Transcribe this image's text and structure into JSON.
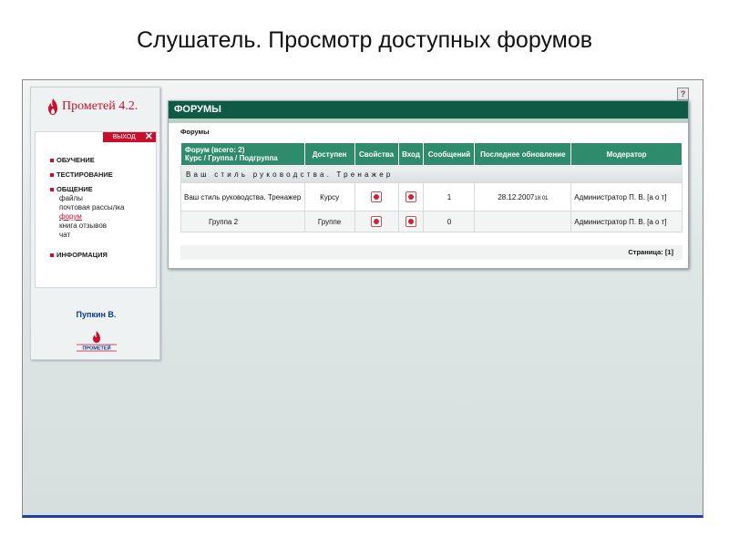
{
  "slide": {
    "title": "Слушатель. Просмотр доступных форумов"
  },
  "app": {
    "help": "?",
    "logo_text": "Прометей 4.2.",
    "logout_label": "ВЫХОД",
    "logout_x": "✕",
    "menu": [
      {
        "label": "ОБУЧЕНИЕ"
      },
      {
        "label": "ТЕСТИРОВАНИЕ"
      },
      {
        "label": "ОБЩЕНИЕ"
      },
      {
        "label": "ИНФОРМАЦИЯ"
      }
    ],
    "submenu": [
      "файлы",
      "почтовая рассылка",
      "форум",
      "книга отзывов",
      "чат"
    ],
    "user_name": "Пупкин В.",
    "bottom_logo_text": "ПРОМЕТЕЙ"
  },
  "panel": {
    "title": "ФОРУМЫ",
    "breadcrumb": "Форумы",
    "columns": {
      "forum": "Форум (всего: 2)",
      "forum_sub": "Курс / Группа / Подгруппа",
      "access": "Доступен",
      "props": "Свойства",
      "enter": "Вход",
      "messages": "Сообщений",
      "updated": "Последнее обновление",
      "moderator": "Модератор"
    },
    "group_row": "Ваш стиль руководства. Тренажер",
    "rows": [
      {
        "name": "Ваш стиль руководства. Тренажер",
        "access": "Курсу",
        "messages": "1",
        "updated": "28.12.2007",
        "updated_time": "18:01",
        "moderator": "Администратор П. В. [а о т]"
      },
      {
        "name": "Группа 2",
        "access": "Группе",
        "messages": "0",
        "updated": "",
        "updated_time": "",
        "moderator": "Администратор П. В. [а о т]"
      }
    ],
    "pager": "Страница: [1]"
  },
  "colors": {
    "header_green": "#0f5a44",
    "table_head": "#2e8c6c",
    "brand_red": "#c8102e"
  }
}
